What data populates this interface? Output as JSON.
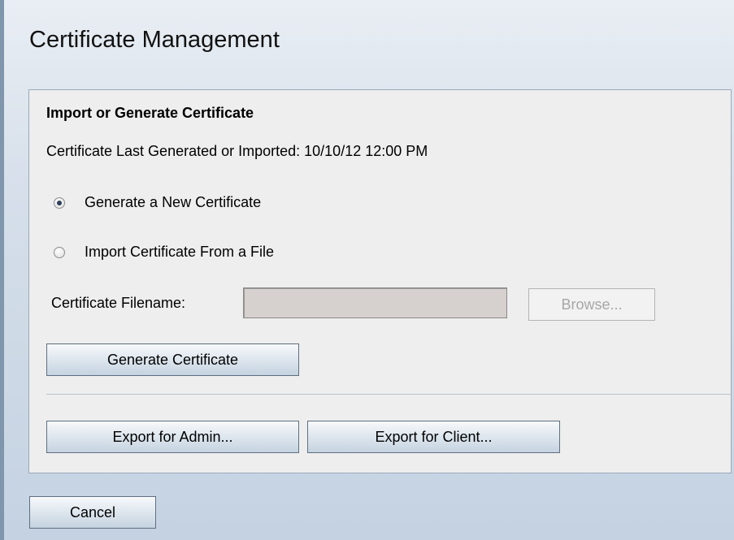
{
  "page": {
    "title": "Certificate Management"
  },
  "section": {
    "title": "Import or Generate Certificate",
    "last_generated_label": "Certificate Last Generated or Imported: 10/10/12 12:00 PM"
  },
  "options": {
    "generate_label": "Generate a New Certificate",
    "generate_selected": true,
    "import_label": "Import Certificate From a File",
    "import_selected": false
  },
  "file": {
    "label": "Certificate Filename:",
    "value": "",
    "browse_label": "Browse..."
  },
  "buttons": {
    "generate": "Generate Certificate",
    "export_admin": "Export for Admin...",
    "export_client": "Export for Client...",
    "cancel": "Cancel"
  },
  "colors": {
    "background": "#d6dfea",
    "panel": "#eeeeee",
    "input_disabled": "#d6d0ce",
    "button_border": "#5f6f80"
  }
}
